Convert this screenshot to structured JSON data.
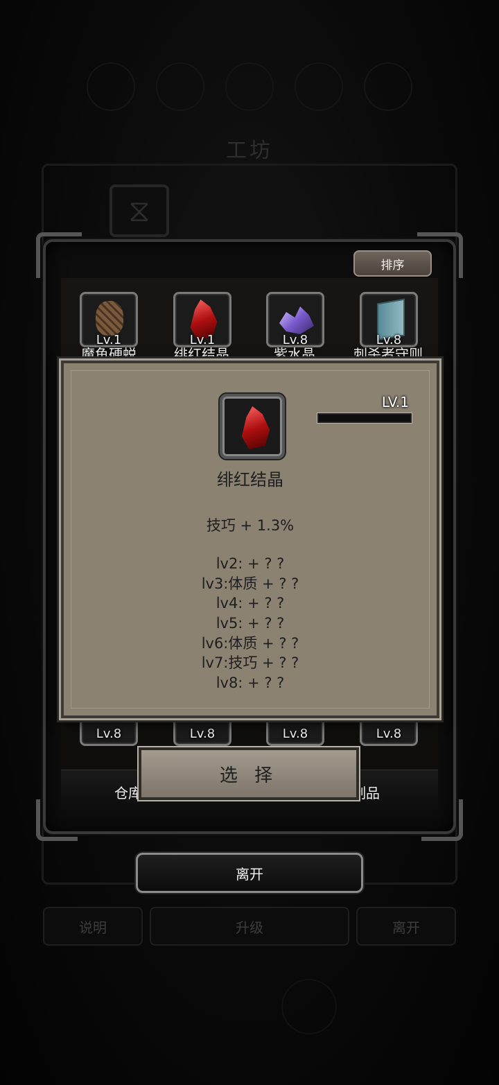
{
  "background": {
    "title": "工坊",
    "buttons": {
      "help": "说明",
      "upgrade": "升级",
      "leave": "离开"
    }
  },
  "inventory": {
    "sort_label": "排序",
    "top_row": [
      {
        "level": "Lv.1",
        "name": "魔鱼硬蜕",
        "icon": "turtle-shell-icon"
      },
      {
        "level": "Lv.1",
        "name": "绯红结晶",
        "icon": "crimson-crystal-icon"
      },
      {
        "level": "Lv.8",
        "name": "紫水晶",
        "icon": "amethyst-icon"
      },
      {
        "level": "Lv.8",
        "name": "刺杀者守则",
        "icon": "book-icon"
      }
    ],
    "bottom_row": [
      {
        "level": "Lv.8"
      },
      {
        "level": "Lv.8"
      },
      {
        "level": "Lv.8"
      },
      {
        "level": "Lv.8"
      }
    ],
    "tabs": {
      "left": "仓库",
      "right": "制品"
    }
  },
  "detail": {
    "level_label": "LV.1",
    "level_progress": 0.0,
    "name": "绯红结晶",
    "stat": "技巧 + 1.3%",
    "upgrades": [
      "lv2: + ? ?",
      "lv3:体质 + ? ?",
      "lv4: + ? ?",
      "lv5: + ? ?",
      "lv6:体质 + ? ?",
      "lv7:技巧 + ? ?",
      "lv8: + ? ?"
    ],
    "select_label": "选 择"
  },
  "leave_label": "离开",
  "colors": {
    "popup_bg": "#8b8272",
    "panel_bg": "#0d0d0d",
    "crimson": "#b01010"
  }
}
